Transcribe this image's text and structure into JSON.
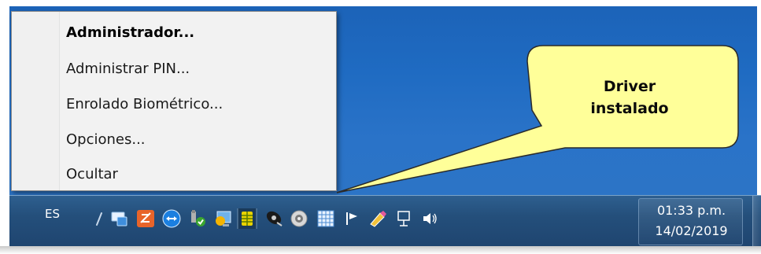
{
  "context_menu": {
    "items": [
      {
        "label": "Administrador...",
        "bold": true
      },
      {
        "label": "Administrar PIN...",
        "bold": false
      },
      {
        "label": "Enrolado Biométrico...",
        "bold": false
      },
      {
        "label": "Opciones...",
        "bold": false
      },
      {
        "label": "Ocultar",
        "bold": false
      }
    ]
  },
  "callout": {
    "line1": "Driver",
    "line2": "instalado",
    "fill_color": "#ffff99"
  },
  "taskbar": {
    "language": "ES",
    "tray_icons": [
      "show-hidden-icons-arrow-icon",
      "network-monitor-icon",
      "orange-app-icon",
      "teamviewer-icon",
      "safely-remove-hardware-icon",
      "display-settings-icon",
      "smartcard-driver-icon",
      "satellite-icon",
      "disc-icon",
      "keyboard-grid-icon",
      "media-play-icon",
      "pencil-paint-icon",
      "wired-network-icon",
      "volume-icon"
    ],
    "clock": {
      "time": "01:33 p.m.",
      "date": "14/02/2019"
    }
  },
  "colors": {
    "desktop": "#1f6bc2",
    "taskbar": "#244f7b",
    "menu_background": "#f2f2f2"
  }
}
